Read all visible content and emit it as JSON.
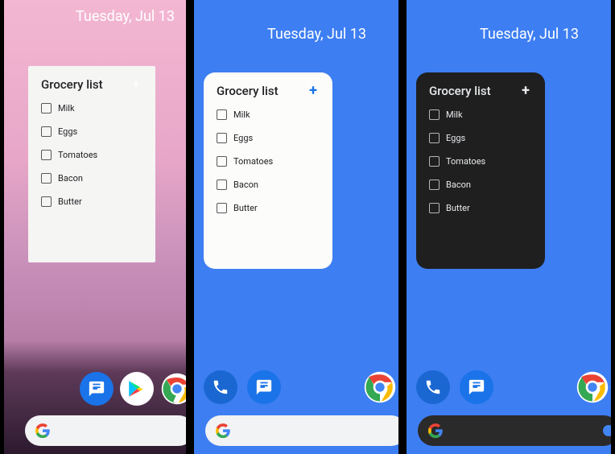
{
  "date_text": "Tuesday, Jul 13",
  "widget": {
    "title": "Grocery list",
    "items": [
      "Milk",
      "Eggs",
      "Tomatoes",
      "Bacon",
      "Butter"
    ]
  },
  "icons": {
    "messages": "messages",
    "play": "play-store",
    "phone": "phone",
    "chrome": "chrome"
  }
}
